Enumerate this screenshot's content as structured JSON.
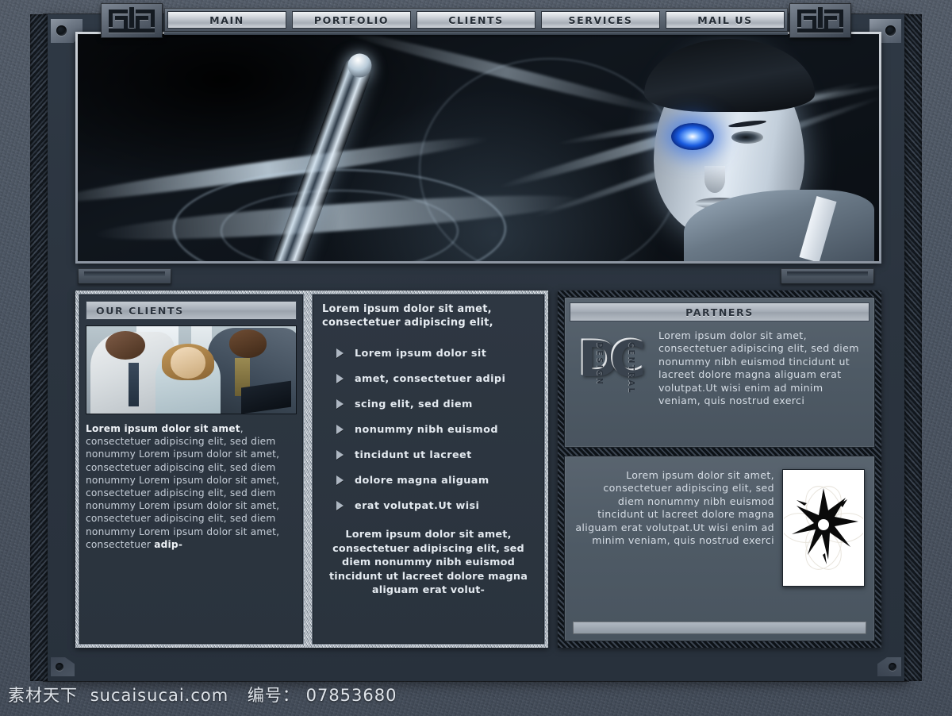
{
  "nav": {
    "items": [
      {
        "label": "MAIN"
      },
      {
        "label": "PORTFOLIO"
      },
      {
        "label": "CLIENTS"
      },
      {
        "label": "SERVICES"
      },
      {
        "label": "MAIL US"
      }
    ]
  },
  "hero": {
    "alt": "cyborg woman with glowing blue cybernetic eye and abstract glass ribbons"
  },
  "clients": {
    "heading": "OUR CLIENTS",
    "photo_alt": "business people in meeting",
    "body_lead": "Lorem ipsum dolor sit amet",
    "body_rest": ", consectetuer adipiscing elit, sed diem nonummy Lorem ipsum dolor sit amet, consectetuer adipiscing elit, sed diem nonummy Lorem ipsum dolor sit amet, consectetuer adipiscing elit, sed diem nonummy Lorem ipsum dolor sit amet, consectetuer adipiscing elit, sed diem nonummy Lorem ipsum dolor sit amet, consectetuer ",
    "body_tail": "adip-"
  },
  "list_section": {
    "intro": "Lorem ipsum dolor sit amet, consectetuer adipiscing elit,",
    "items": [
      "Lorem ipsum dolor sit",
      "amet, consectetuer adipi",
      "scing elit, sed diem",
      "nonummy nibh euismod",
      "tincidunt ut lacreet",
      "dolore magna aliguam",
      "erat volutpat.Ut wisi"
    ],
    "outro": "Lorem ipsum dolor sit amet, consectetuer adipiscing elit, sed diem nonummy nibh euismod tincidunt ut lacreet dolore magna aliguam erat volut-"
  },
  "partners": {
    "heading": "PARTNERS",
    "logo": {
      "letter_d": "D",
      "letter_c": "C",
      "word_design": "DESIGN",
      "word_central": "CENTRAL"
    },
    "body": "Lorem ipsum dolor sit amet, consectetuer adipiscing elit, sed diem nonummy nibh euismod tincidunt ut lacreet dolore magna aliguam erat volutpat.Ut wisi enim ad minim veniam, quis nostrud exerci"
  },
  "extra_panel": {
    "body": "Lorem ipsum dolor sit amet, consectetuer adipiscing elit, sed diem nonummy nibh euismod tincidunt ut lacreet dolore magna aliguam erat volutpat.Ut wisi enim ad minim veniam, quis nostrud exerci",
    "art_alt": "black ink splatter star graphic"
  },
  "watermark": {
    "site_cn": "素材天下",
    "site_url": "sucaisucai.com",
    "id_label": "编号：",
    "id_value": "07853680"
  },
  "colors": {
    "page_bg": "#4a5360",
    "frame": "#2b343f",
    "panel": "#2e3742",
    "accent_silver": "#c5cbd2",
    "text": "#c6ced8",
    "eye_blue": "#1a5ce0"
  }
}
